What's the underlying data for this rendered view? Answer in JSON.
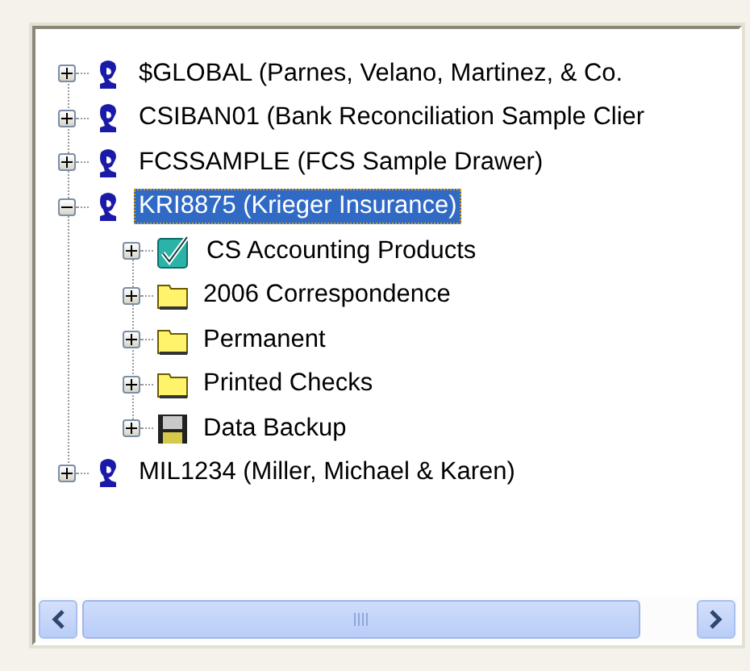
{
  "tree": [
    {
      "kind": "client",
      "label": "$GLOBAL (Parnes, Velano, Martinez, & Co.",
      "expanded": false,
      "selected": false
    },
    {
      "kind": "client",
      "label": "CSIBAN01 (Bank Reconciliation Sample Clier",
      "expanded": false,
      "selected": false
    },
    {
      "kind": "client",
      "label": "FCSSAMPLE (FCS Sample Drawer)",
      "expanded": false,
      "selected": false
    },
    {
      "kind": "client",
      "label": "KRI8875 (Krieger Insurance)",
      "expanded": true,
      "selected": true,
      "children": [
        {
          "kind": "product",
          "label": "CS Accounting Products",
          "expanded": false,
          "selected": false
        },
        {
          "kind": "folder",
          "label": "2006 Correspondence",
          "expanded": false,
          "selected": false
        },
        {
          "kind": "folder",
          "label": "Permanent",
          "expanded": false,
          "selected": false
        },
        {
          "kind": "folder",
          "label": "Printed Checks",
          "expanded": false,
          "selected": false
        },
        {
          "kind": "disk",
          "label": "Data Backup",
          "expanded": false,
          "selected": false
        }
      ]
    },
    {
      "kind": "client",
      "label": "MIL1234 (Miller, Michael & Karen)",
      "expanded": false,
      "selected": false
    }
  ]
}
